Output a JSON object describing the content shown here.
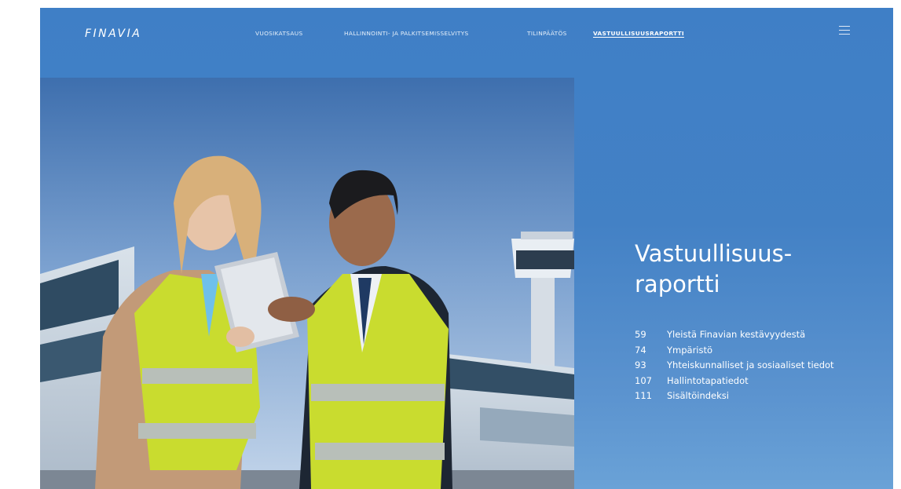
{
  "header": {
    "logo": "FINAVIA",
    "nav": [
      {
        "label": "VUOSIKATSAUS",
        "active": false
      },
      {
        "label": "HALLINNOINTI- JA PALKITSEMISSELVITYS",
        "active": false
      },
      {
        "label": "TILINPÄÄTÖS",
        "active": false
      },
      {
        "label": "VASTUULLISUUSRAPORTTI",
        "active": true
      }
    ],
    "menu_icon": "hamburger-menu-icon"
  },
  "main": {
    "title_line1": "Vastuullisuus-",
    "title_line2": "raportti",
    "toc": [
      {
        "page": "59",
        "label": "Yleistä Finavian kestävyydestä"
      },
      {
        "page": "74",
        "label": "Ympäristö"
      },
      {
        "page": "93",
        "label": "Yhteiskunnalliset ja sosiaaliset tiedot"
      },
      {
        "page": "107",
        "label": "Hallintotapatiedot"
      },
      {
        "page": "111",
        "label": "Sisältöindeksi"
      }
    ]
  },
  "colors": {
    "background": "#4381c5",
    "text": "#ffffff",
    "vest": "#c9dc2f"
  }
}
